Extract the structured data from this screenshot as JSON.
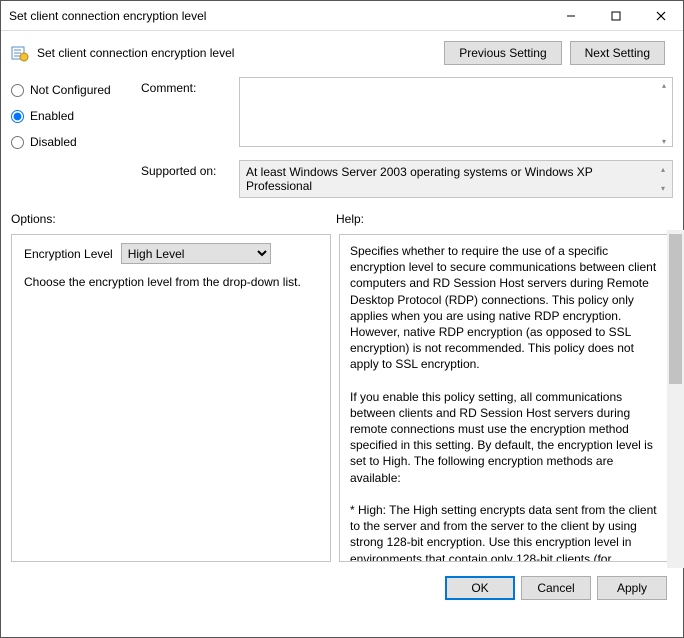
{
  "window": {
    "title": "Set client connection encryption level"
  },
  "header": {
    "title": "Set client connection encryption level",
    "prev": "Previous Setting",
    "next": "Next Setting"
  },
  "state": {
    "not_configured": "Not Configured",
    "enabled": "Enabled",
    "disabled": "Disabled",
    "selected": "enabled"
  },
  "fields": {
    "comment_label": "Comment:",
    "comment_value": "",
    "supported_label": "Supported on:",
    "supported_value": "At least Windows Server 2003 operating systems or Windows XP Professional"
  },
  "sections": {
    "options": "Options:",
    "help": "Help:"
  },
  "options_panel": {
    "enc_label": "Encryption Level",
    "enc_value": "High Level",
    "enc_choices": [
      "High Level"
    ],
    "hint": "Choose the encryption level from the drop-down list."
  },
  "help_panel": {
    "text": "Specifies whether to require the use of a specific encryption level to secure communications between client computers and RD Session Host servers during Remote Desktop Protocol (RDP) connections. This policy only applies when you are using native RDP encryption. However, native RDP encryption (as opposed to SSL encryption) is not recommended. This policy does not apply to SSL encryption.\n\nIf you enable this policy setting, all communications between clients and RD Session Host servers during remote connections must use the encryption method specified in this setting. By default, the encryption level is set to High. The following encryption methods are available:\n\n* High: The High setting encrypts data sent from the client to the server and from the server to the client by using strong 128-bit encryption. Use this encryption level in environments that contain only 128-bit clients (for example, clients that run Remote Desktop Connection). Clients that do not support this encryption level cannot connect to RD Session Host servers."
  },
  "footer": {
    "ok": "OK",
    "cancel": "Cancel",
    "apply": "Apply"
  }
}
